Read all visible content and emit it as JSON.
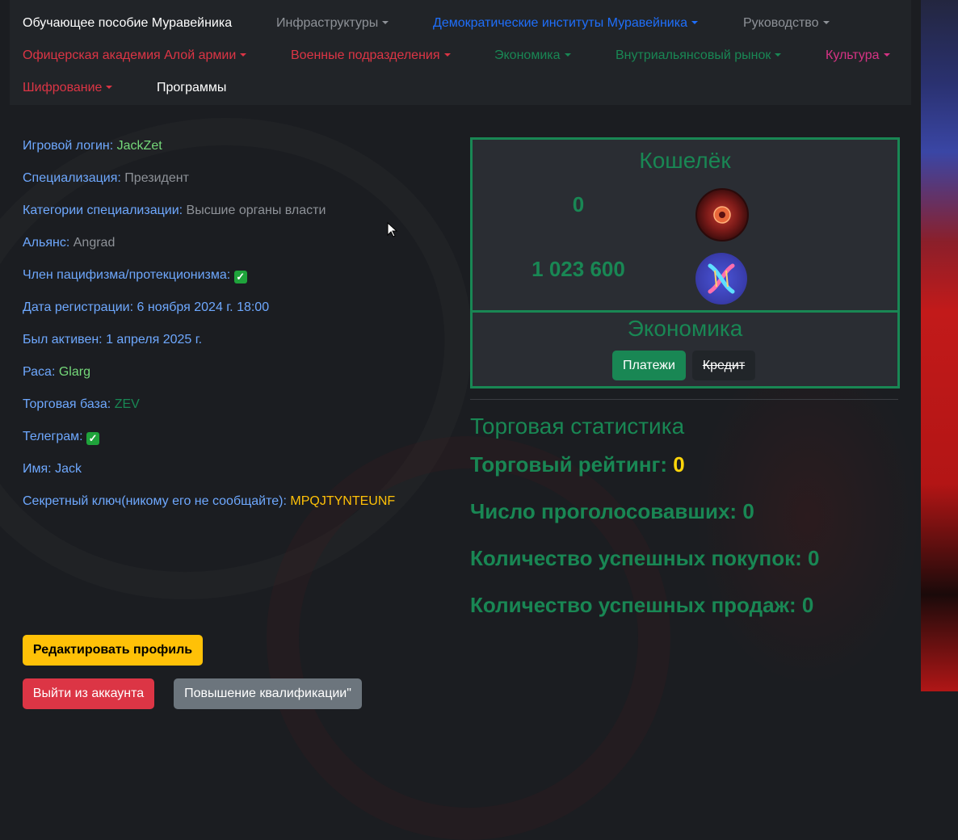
{
  "navbar": {
    "brand": "Обучающее пособие Муравейника",
    "items": [
      {
        "label": "Инфраструктуры"
      },
      {
        "label": "Демократические институты Муравейника"
      },
      {
        "label": "Руководство"
      },
      {
        "label": "Офицерская академия Алой армии"
      },
      {
        "label": "Военные подразделения"
      },
      {
        "label": "Экономика"
      },
      {
        "label": "Внутриальянсовый рынок"
      },
      {
        "label": "Культура"
      },
      {
        "label": "Шифрование"
      },
      {
        "label": "Программы"
      }
    ]
  },
  "profile": {
    "login_label": "Игровой логин:",
    "login": "JackZet",
    "spec_label": "Специализация:",
    "spec": "Президент",
    "spec_cat_label": "Категории специализации:",
    "spec_cat": "Высшие органы власти",
    "alliance_label": "Альянс:",
    "alliance": "Angrad",
    "pacifism_label": "Член пацифизма/протекционизма:",
    "pacifism_check": "✓",
    "reg_label": "Дата регистрации:",
    "reg": "6 ноября 2024 г. 18:00",
    "active_label": "Был активен:",
    "active": "1 апреля 2025 г.",
    "race_label": "Раса:",
    "race": "Glarg",
    "base_label": "Торговая база:",
    "base": "ZEV",
    "telegram_label": "Телеграм:",
    "telegram_check": "✓",
    "name_label": "Имя:",
    "name": "Jack",
    "secret_label": "Секретный ключ(никому его не сообщайте):",
    "secret": "MPQJTYNTEUNF"
  },
  "wallet": {
    "title": "Кошелёк",
    "amount1": "0",
    "amount2": "1 023 600",
    "coin1_icon": "red-coin-icon",
    "coin2_icon": "dna-coin-icon"
  },
  "economy": {
    "title": "Экономика",
    "payments_label": "Платежи",
    "credit_label": "Кредит"
  },
  "stats": {
    "title": "Торговая статистика",
    "rating_label": "Торговый рейтинг:",
    "rating": "0",
    "voters": "Число проголосовавших: 0",
    "buys": "Количество успешных покупок: 0",
    "sales": "Количество успешных продаж: 0"
  },
  "actions": {
    "edit_label": "Редактировать профиль",
    "logout_label": "Выйти из аккаунта",
    "qualification_label": "Повышение квалификации\""
  },
  "colors": {
    "accent_green": "#198754",
    "link_blue": "#6ea8fe",
    "warning_yellow": "#ffc107",
    "danger_red": "#dc3545"
  }
}
